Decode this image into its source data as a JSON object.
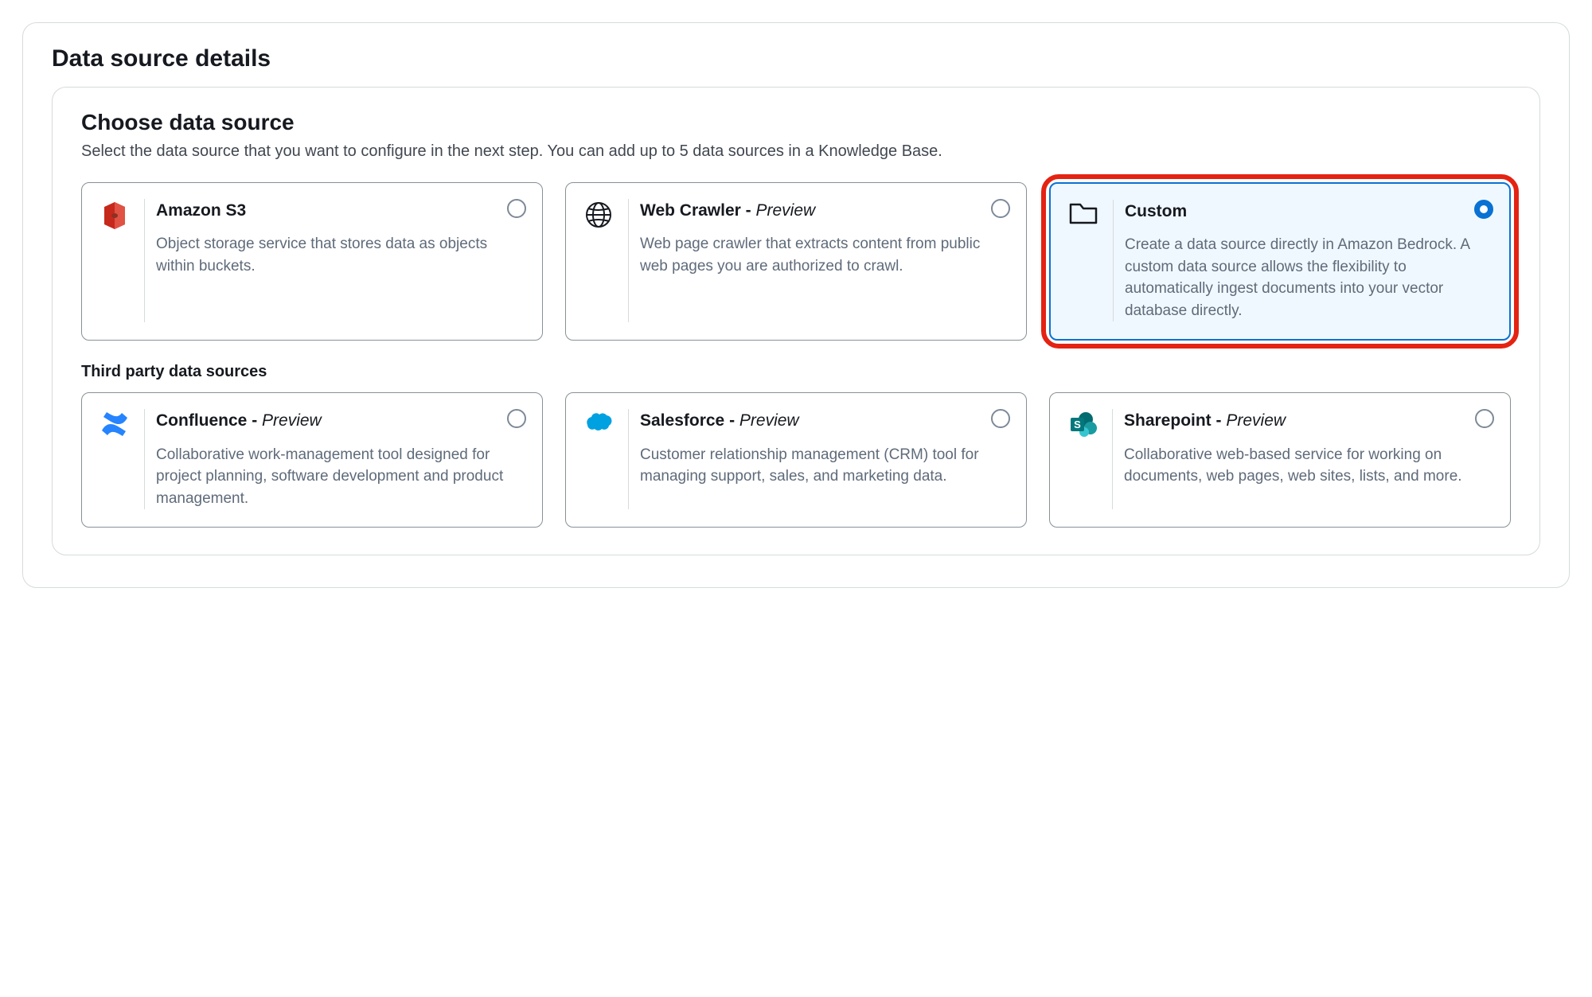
{
  "panel": {
    "title": "Data source details",
    "choose_heading": "Choose data source",
    "choose_subtitle": "Select the data source that you want to configure in the next step. You can add up to 5 data sources in a Knowledge Base.",
    "third_party_heading": "Third party data sources",
    "preview_tag": "Preview"
  },
  "sources": {
    "s3": {
      "title": "Amazon S3",
      "preview": false,
      "selected": false,
      "desc": "Object storage service that stores data as objects within buckets."
    },
    "web": {
      "title": "Web Crawler",
      "preview": true,
      "selected": false,
      "desc": "Web page crawler that extracts content from public web pages you are authorized to crawl."
    },
    "custom": {
      "title": "Custom",
      "preview": false,
      "selected": true,
      "desc": "Create a data source directly in Amazon Bedrock. A custom data source allows the flexibility to automatically ingest documents into your vector database directly."
    },
    "confluence": {
      "title": "Confluence",
      "preview": true,
      "selected": false,
      "desc": "Collaborative work-management tool designed for project planning, software development and product management."
    },
    "salesforce": {
      "title": "Salesforce",
      "preview": true,
      "selected": false,
      "desc": "Customer relationship management (CRM) tool for managing support, sales, and marketing data."
    },
    "sharepoint": {
      "title": "Sharepoint",
      "preview": true,
      "selected": false,
      "desc": "Collaborative web-based service for working on documents, web pages, web sites, lists, and more."
    }
  }
}
